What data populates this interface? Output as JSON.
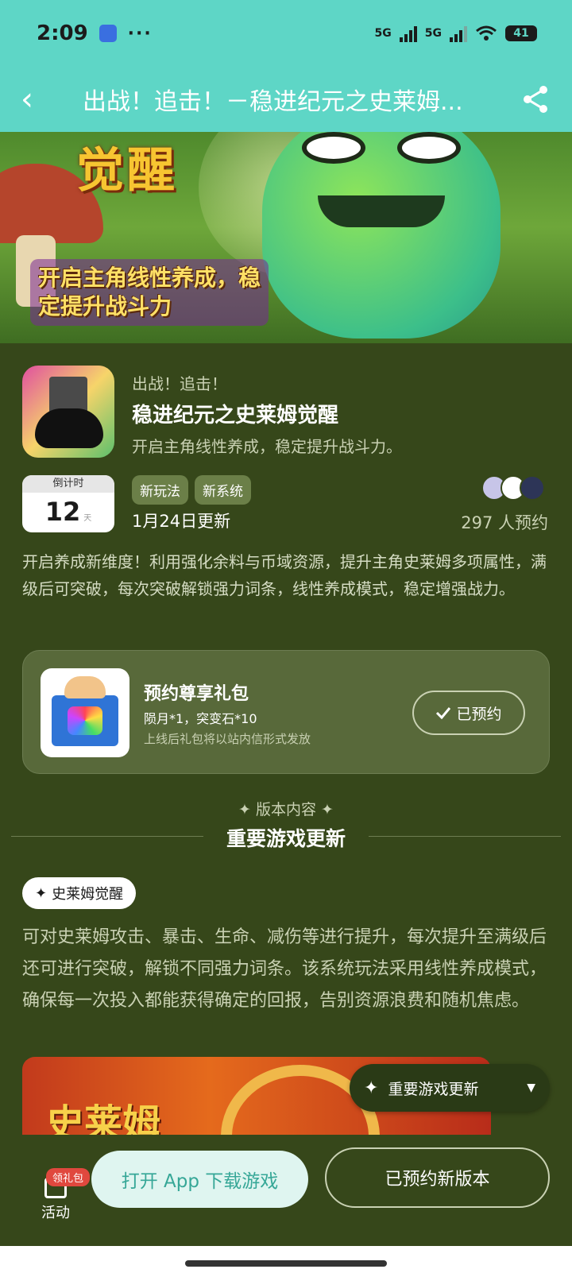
{
  "status_bar": {
    "time": "2:09",
    "more": "···",
    "network_1": "5G",
    "network_2": "5G",
    "battery": "41"
  },
  "header": {
    "back": "‹",
    "title": "出战！追击！－稳进纪元之史莱姆..."
  },
  "banner": {
    "title": "觉醒",
    "subtitle": "开启主角线性养成，稳定提升战斗力"
  },
  "app": {
    "kicker": "出战！追击！",
    "name": "稳进纪元之史莱姆觉醒",
    "description": "开启主角线性养成，稳定提升战斗力。"
  },
  "countdown": {
    "label": "倒计时",
    "value": "12",
    "unit": "天"
  },
  "tags": [
    "新玩法",
    "新系统"
  ],
  "update_date": "1月24日更新",
  "reserve_count": "297 人预约",
  "intro": "开启养成新维度！利用强化余料与币域资源，提升主角史莱姆多项属性，满级后可突破，每次突破解锁强力词条，线性养成模式，稳定增强战力。",
  "gift": {
    "title": "预约尊享礼包",
    "items": "陨月*1，突变石*10",
    "note": "上线后礼包将以站内信形式发放",
    "button_label": "已预约",
    "button_icon": "check-icon"
  },
  "section": {
    "kicker": "✦ 版本内容 ✦",
    "title": "重要游戏更新"
  },
  "feature": {
    "chip": "史莱姆觉醒",
    "body": "可对史莱姆攻击、暴击、生命、减伤等进行提升，每次提升至满级后还可进行突破，解锁不同强力词条。该系统玩法采用线性养成模式，确保每一次投入都能获得确定的回报，告别资源浪费和随机焦虑。"
  },
  "promo": {
    "text": "史莱姆"
  },
  "float_menu": {
    "label": "重要游戏更新"
  },
  "bottom_bar": {
    "activity_badge": "领礼包",
    "activity_label": "活动",
    "open_app": "打开 App 下载游戏",
    "reserved_new_version": "已预约新版本"
  },
  "colors": {
    "header_bg": "#5ed6c6",
    "page_bg": "#36471a",
    "card_bg": "#58693a",
    "badge_red": "#e0483e",
    "open_app_text": "#36a797"
  }
}
